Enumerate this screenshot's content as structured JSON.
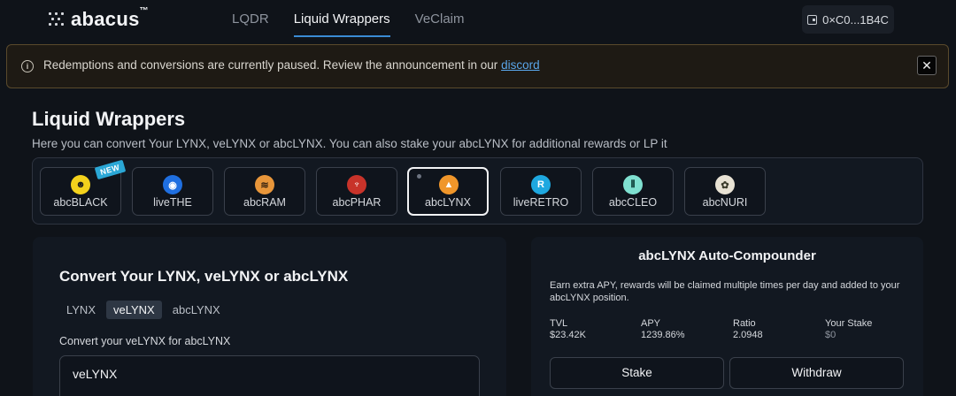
{
  "app": {
    "name": "abacus",
    "trademark": "™"
  },
  "nav": {
    "items": [
      {
        "label": "LQDR",
        "active": false
      },
      {
        "label": "Liquid Wrappers",
        "active": true
      },
      {
        "label": "VeClaim",
        "active": false
      }
    ]
  },
  "wallet": {
    "address": "0×C0...1B4C",
    "icon": "wallet-icon"
  },
  "alert": {
    "text": "Redemptions and conversions are currently paused. Review the announcement in our ",
    "link_text": "discord",
    "close_label": "✕",
    "info_glyph": "i"
  },
  "page": {
    "title": "Liquid Wrappers",
    "subtitle": "Here you can convert Your LYNX, veLYNX or abcLYNX. You can also stake your abcLYNX for additional rewards or LP it"
  },
  "tokens": [
    {
      "label": "abcBLACK",
      "badge": "NEW",
      "icon": "face-icon",
      "bg": "#f4d21c",
      "fg": "#1a1a1a",
      "glyph": "☻",
      "active": false
    },
    {
      "label": "liveTHE",
      "icon": "the-icon",
      "bg": "#1f6fe0",
      "fg": "#ffffff",
      "glyph": "◉",
      "active": false
    },
    {
      "label": "abcRAM",
      "icon": "ram-icon",
      "bg": "#e8963a",
      "fg": "#3a2410",
      "glyph": "≋",
      "active": false
    },
    {
      "label": "abcPHAR",
      "icon": "phar-icon",
      "bg": "#c8332a",
      "fg": "#ffffff",
      "glyph": "♆",
      "active": false
    },
    {
      "label": "abcLYNX",
      "icon": "lynx-icon",
      "bg": "#f0962a",
      "fg": "#ffffff",
      "glyph": "▲",
      "active": true
    },
    {
      "label": "liveRETRO",
      "icon": "retro-icon",
      "bg": "#1ea8e0",
      "fg": "#ffffff",
      "glyph": "R",
      "active": false
    },
    {
      "label": "abcCLEO",
      "icon": "cleo-icon",
      "bg": "#7fe0d0",
      "fg": "#0a3a34",
      "glyph": "⦀",
      "active": false
    },
    {
      "label": "abcNURI",
      "icon": "nuri-icon",
      "bg": "#e8e2d4",
      "fg": "#3a3a2a",
      "glyph": "✿",
      "active": false
    }
  ],
  "convert": {
    "title": "Convert Your LYNX, veLYNX or abcLYNX",
    "tabs": [
      {
        "label": "LYNX",
        "active": false
      },
      {
        "label": "veLYNX",
        "active": true
      },
      {
        "label": "abcLYNX",
        "active": false
      }
    ],
    "label": "Convert your veLYNX for abcLYNX",
    "input_token": "veLYNX"
  },
  "compounder": {
    "title": "abcLYNX Auto-Compounder",
    "description": "Earn extra APY, rewards will be claimed multiple times per day and added to your abcLYNX position.",
    "stats": [
      {
        "label": "TVL",
        "value": "$23.42K",
        "muted": false
      },
      {
        "label": "APY",
        "value": "1239.86%",
        "muted": false
      },
      {
        "label": "Ratio",
        "value": "2.0948",
        "muted": false
      },
      {
        "label": "Your Stake",
        "value": "$0",
        "muted": true
      }
    ],
    "stake_label": "Stake",
    "withdraw_label": "Withdraw"
  }
}
